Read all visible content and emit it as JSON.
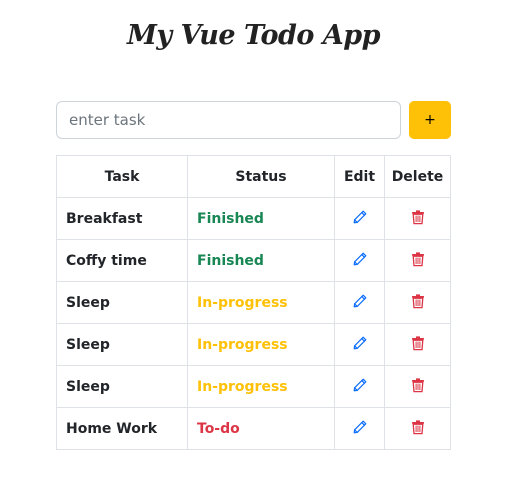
{
  "app": {
    "title": "My Vue Todo App"
  },
  "form": {
    "input_placeholder": "enter task",
    "input_value": "",
    "add_label": "+"
  },
  "table": {
    "headers": [
      "Task",
      "Status",
      "Edit",
      "Delete"
    ],
    "rows": [
      {
        "task": "Breakfast",
        "status": "Finished",
        "status_color": "#198754"
      },
      {
        "task": "Coffy time",
        "status": "Finished",
        "status_color": "#198754"
      },
      {
        "task": "Sleep",
        "status": "In-progress",
        "status_color": "#ffc107"
      },
      {
        "task": "Sleep",
        "status": "In-progress",
        "status_color": "#ffc107"
      },
      {
        "task": "Sleep",
        "status": "In-progress",
        "status_color": "#ffc107"
      },
      {
        "task": "Home Work",
        "status": "To-do",
        "status_color": "#dc3545"
      }
    ]
  },
  "colors": {
    "accent": "#ffc107",
    "edit_icon": "#0d6efd",
    "delete_icon": "#dc3545"
  },
  "icons": {
    "edit": "pencil-icon",
    "delete": "trash-icon"
  }
}
